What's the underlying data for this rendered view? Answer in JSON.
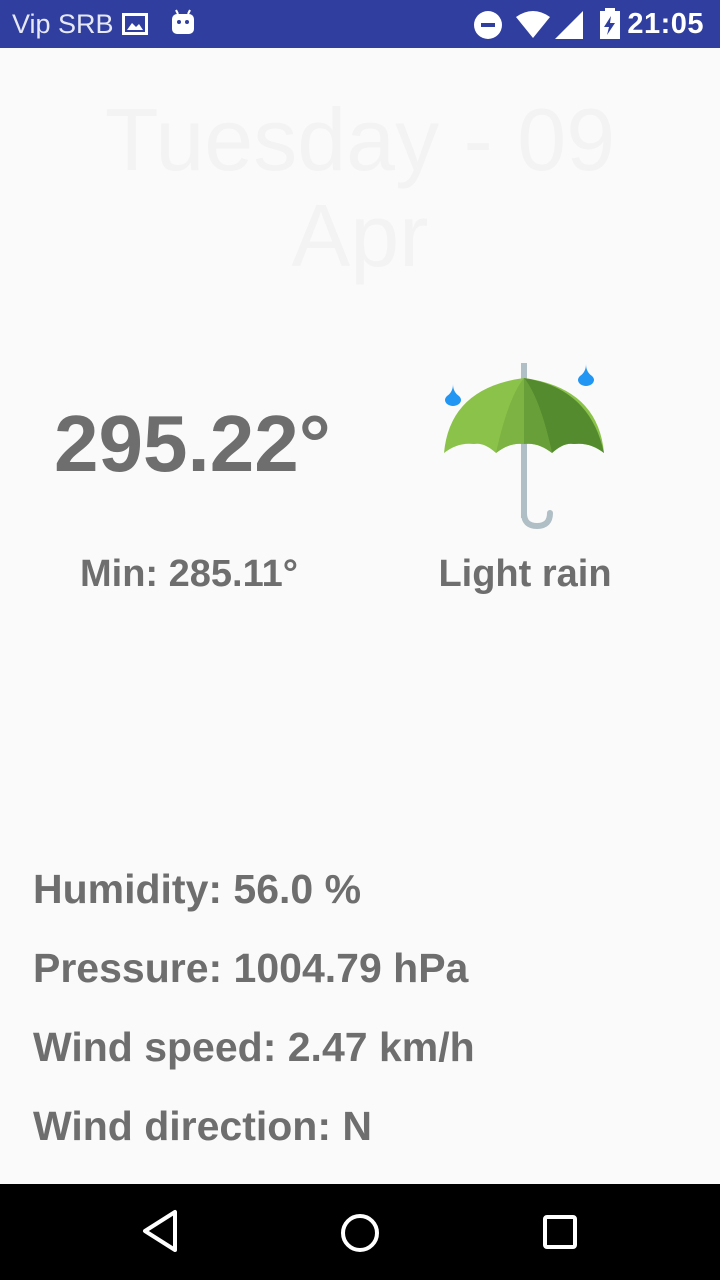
{
  "status_bar": {
    "carrier": "Vip SRB",
    "time": "21:05",
    "icons": [
      "image-icon",
      "android-icon",
      "do-not-disturb-icon",
      "wifi-icon",
      "signal-icon",
      "battery-charging-icon"
    ]
  },
  "header": {
    "date": "Tuesday - 09 Apr"
  },
  "forecast": {
    "temperature": "295.22°",
    "min_temperature": "Min: 285.11°",
    "condition": "Light rain",
    "icon": "umbrella-rain-icon",
    "colors": {
      "text": "#6e6e6e",
      "umbrella_light": "#8bc34a",
      "umbrella_dark": "#689f38",
      "drop": "#2196f3"
    }
  },
  "details": {
    "humidity": "Humidity: 56.0 %",
    "pressure": "Pressure: 1004.79 hPa",
    "wind_speed": "Wind speed: 2.47 km/h",
    "wind_direction": "Wind direction: N"
  },
  "nav_bar": {
    "buttons": [
      "back-icon",
      "home-icon",
      "recents-icon"
    ]
  }
}
